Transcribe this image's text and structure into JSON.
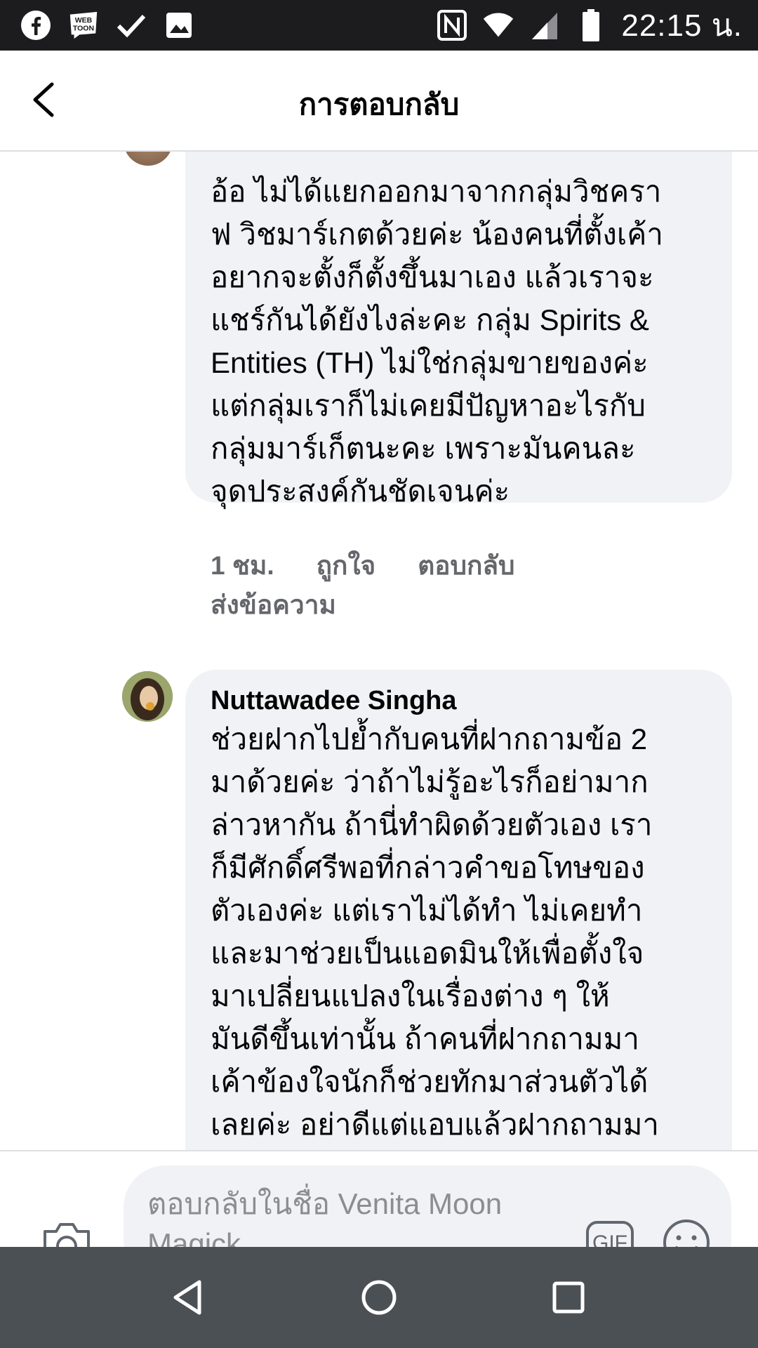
{
  "status_bar": {
    "time": "22:15 น.",
    "icons": [
      "facebook-icon",
      "webtoon-icon",
      "check-icon",
      "image-icon",
      "nfc-icon",
      "wifi-icon",
      "signal-icon",
      "battery-icon"
    ],
    "webtoon_text": "WEB\nTOON"
  },
  "header": {
    "title": "การตอบกลับ"
  },
  "comments": [
    {
      "author": "",
      "text": "อ้อ ไม่ได้แยกออกมาจากกลุ่มวิชคราฟ วิชมาร์เกตด้วยค่ะ น้องคนที่ตั้งเค้าอยากจะตั้งก็ตั้งขึ้นมาเอง แล้วเราจะแชร์กันได้ยังไงล่ะคะ กลุ่ม Spirits & Entities (TH) ไม่ใช่กลุ่มขายของค่ะ แต่กลุ่มเราก็ไม่เคยมีปัญหาอะไรกับกลุ่มมาร์เก็ตนะคะ เพราะมันคนละจุดประสงค์กันชัดเจนค่ะ",
      "time": "1 ชม.",
      "like": "ถูกใจ",
      "reply": "ตอบกลับ",
      "message": "ส่งข้อความ"
    },
    {
      "author": "Nuttawadee Singha",
      "text": "ช่วยฝากไปย้ำกับคนที่ฝากถามข้อ 2 มาด้วยค่ะ ว่าถ้าไม่รู้อะไรก็อย่ามากล่าวหากัน ถ้านี่ทำผิดด้วยตัวเอง เราก็มีศักดิ์ศรีพอที่กล่าวคำขอโทษของตัวเองค่ะ แต่เราไม่ได้ทำ ไม่เคยทำ และมาช่วยเป็นแอดมินให้เพื่อตั้งใจมาเปลี่ยนแปลงในเรื่องต่าง ๆ ให้มันดีขึ้นเท่านั้น ถ้าคนที่ฝากถามมาเค้าข้องใจนักก็ช่วยทักมาส่วนตัวได้เลยค่ะ อย่าดีแต่แอบแล้วฝากถามมา"
    }
  ],
  "comment_lines": {
    "c1": "อ้อ ไม่ได้แยกออกมาจากกลุ่มวิชครา\nฟ วิชมาร์เกตด้วยค่ะ น้องคนที่ตั้งเค้า\nอยากจะตั้งก็ตั้งขึ้นมาเอง แล้วเราจะ\nแชร์กันได้ยังไงล่ะคะ กลุ่ม Spirits &\nEntities (TH) ไม่ใช่กลุ่มขายของค่ะ\nแต่กลุ่มเราก็ไม่เคยมีปัญหาอะไรกับ\nกลุ่มมาร์เก็ตนะคะ เพราะมันคนละ\nจุดประสงค์กันชัดเจนค่ะ",
    "c2": "ช่วยฝากไปย้ำกับคนที่ฝากถามข้อ 2\nมาด้วยค่ะ ว่าถ้าไม่รู้อะไรก็อย่ามาก\nล่าวหากัน ถ้านี่ทำผิดด้วยตัวเอง เรา\nก็มีศักดิ์ศรีพอที่กล่าวคำขอโทษของ\nตัวเองค่ะ แต่เราไม่ได้ทำ ไม่เคยทำ\nและมาช่วยเป็นแอดมินให้เพื่อตั้งใจ\nมาเปลี่ยนแปลงในเรื่องต่าง ๆ ให้\nมันดีขึ้นเท่านั้น ถ้าคนที่ฝากถามมา\nเค้าข้องใจนักก็ช่วยทักมาส่วนตัวได้\nเลยค่ะ อย่าดีแต่แอบแล้วฝากถามมา"
  },
  "composer": {
    "placeholder": "ตอบกลับในชื่อ Venita Moon Magick",
    "gif_label": "GIF"
  },
  "colors": {
    "bubble": "#f0f2f5",
    "meta": "#65676b",
    "navbar": "#4b5055",
    "statusbar": "#1c1c1e"
  }
}
